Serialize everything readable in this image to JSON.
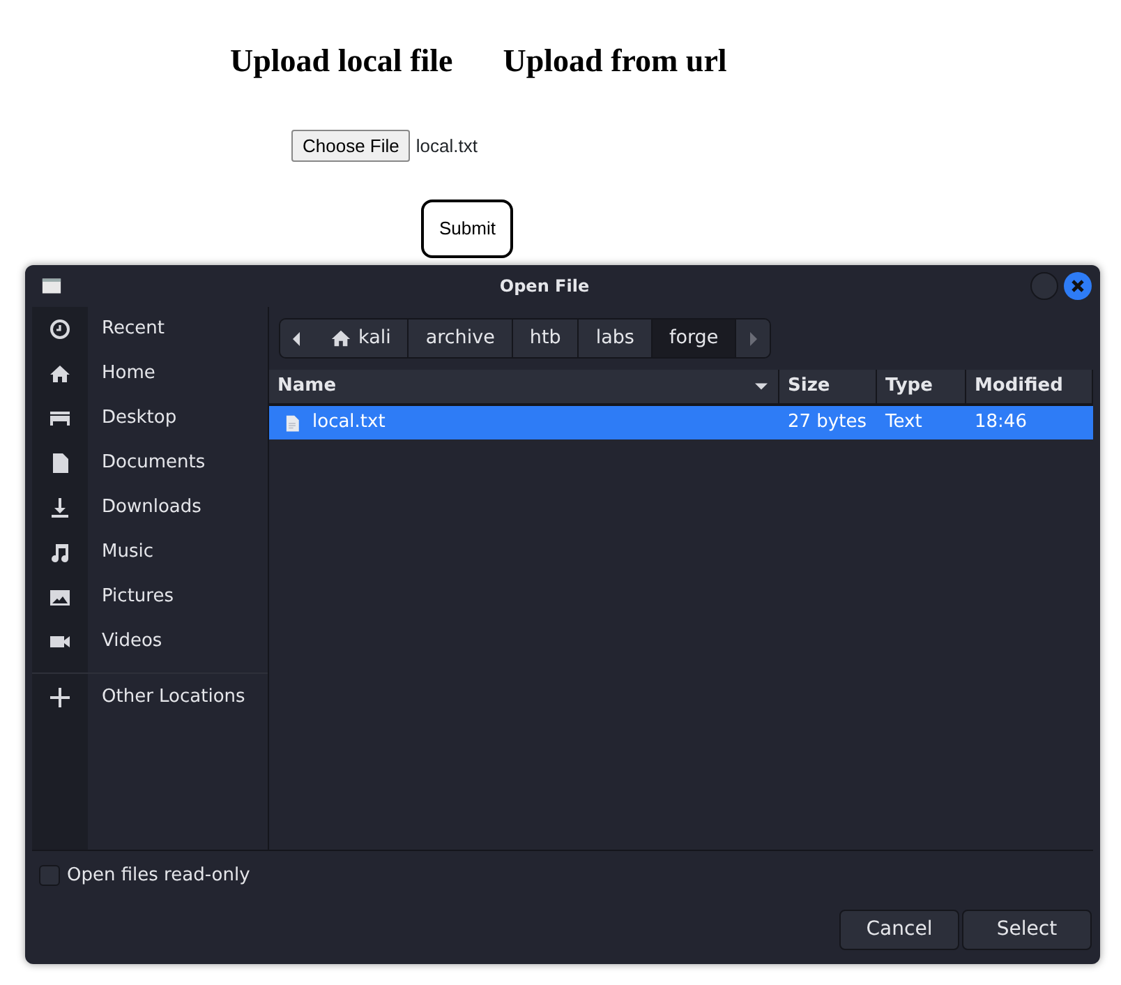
{
  "page": {
    "headings": [
      {
        "label": "Upload local file"
      },
      {
        "label": "Upload from url"
      }
    ],
    "file_button": "Choose File",
    "file_name": "local.txt",
    "submit": "Submit"
  },
  "dialog": {
    "title": "Open File",
    "sidebar": {
      "items": [
        {
          "label": "Recent",
          "kind": "recent"
        },
        {
          "label": "Home",
          "kind": "home"
        },
        {
          "label": "Desktop",
          "kind": "desktop"
        },
        {
          "label": "Documents",
          "kind": "documents"
        },
        {
          "label": "Downloads",
          "kind": "downloads"
        },
        {
          "label": "Music",
          "kind": "music"
        },
        {
          "label": "Pictures",
          "kind": "pictures"
        },
        {
          "label": "Videos",
          "kind": "videos"
        },
        {
          "label": "Other Locations",
          "kind": "other"
        }
      ]
    },
    "path": [
      {
        "label": "kali",
        "kind": "home",
        "selected": false
      },
      {
        "label": "archive",
        "kind": "folder",
        "selected": false
      },
      {
        "label": "htb",
        "kind": "folder",
        "selected": false
      },
      {
        "label": "labs",
        "kind": "folder",
        "selected": false
      },
      {
        "label": "forge",
        "kind": "folder",
        "selected": true
      }
    ],
    "table": {
      "columns": [
        "Name",
        "Size",
        "Type",
        "Modified"
      ],
      "rows": [
        {
          "name": "local.txt",
          "size": "27 bytes",
          "type": "Text",
          "modified": "18:46",
          "selected": true
        }
      ]
    },
    "read_only": {
      "label": "Open files read-only",
      "checked": false
    },
    "buttons": [
      "Cancel",
      "Select"
    ]
  }
}
